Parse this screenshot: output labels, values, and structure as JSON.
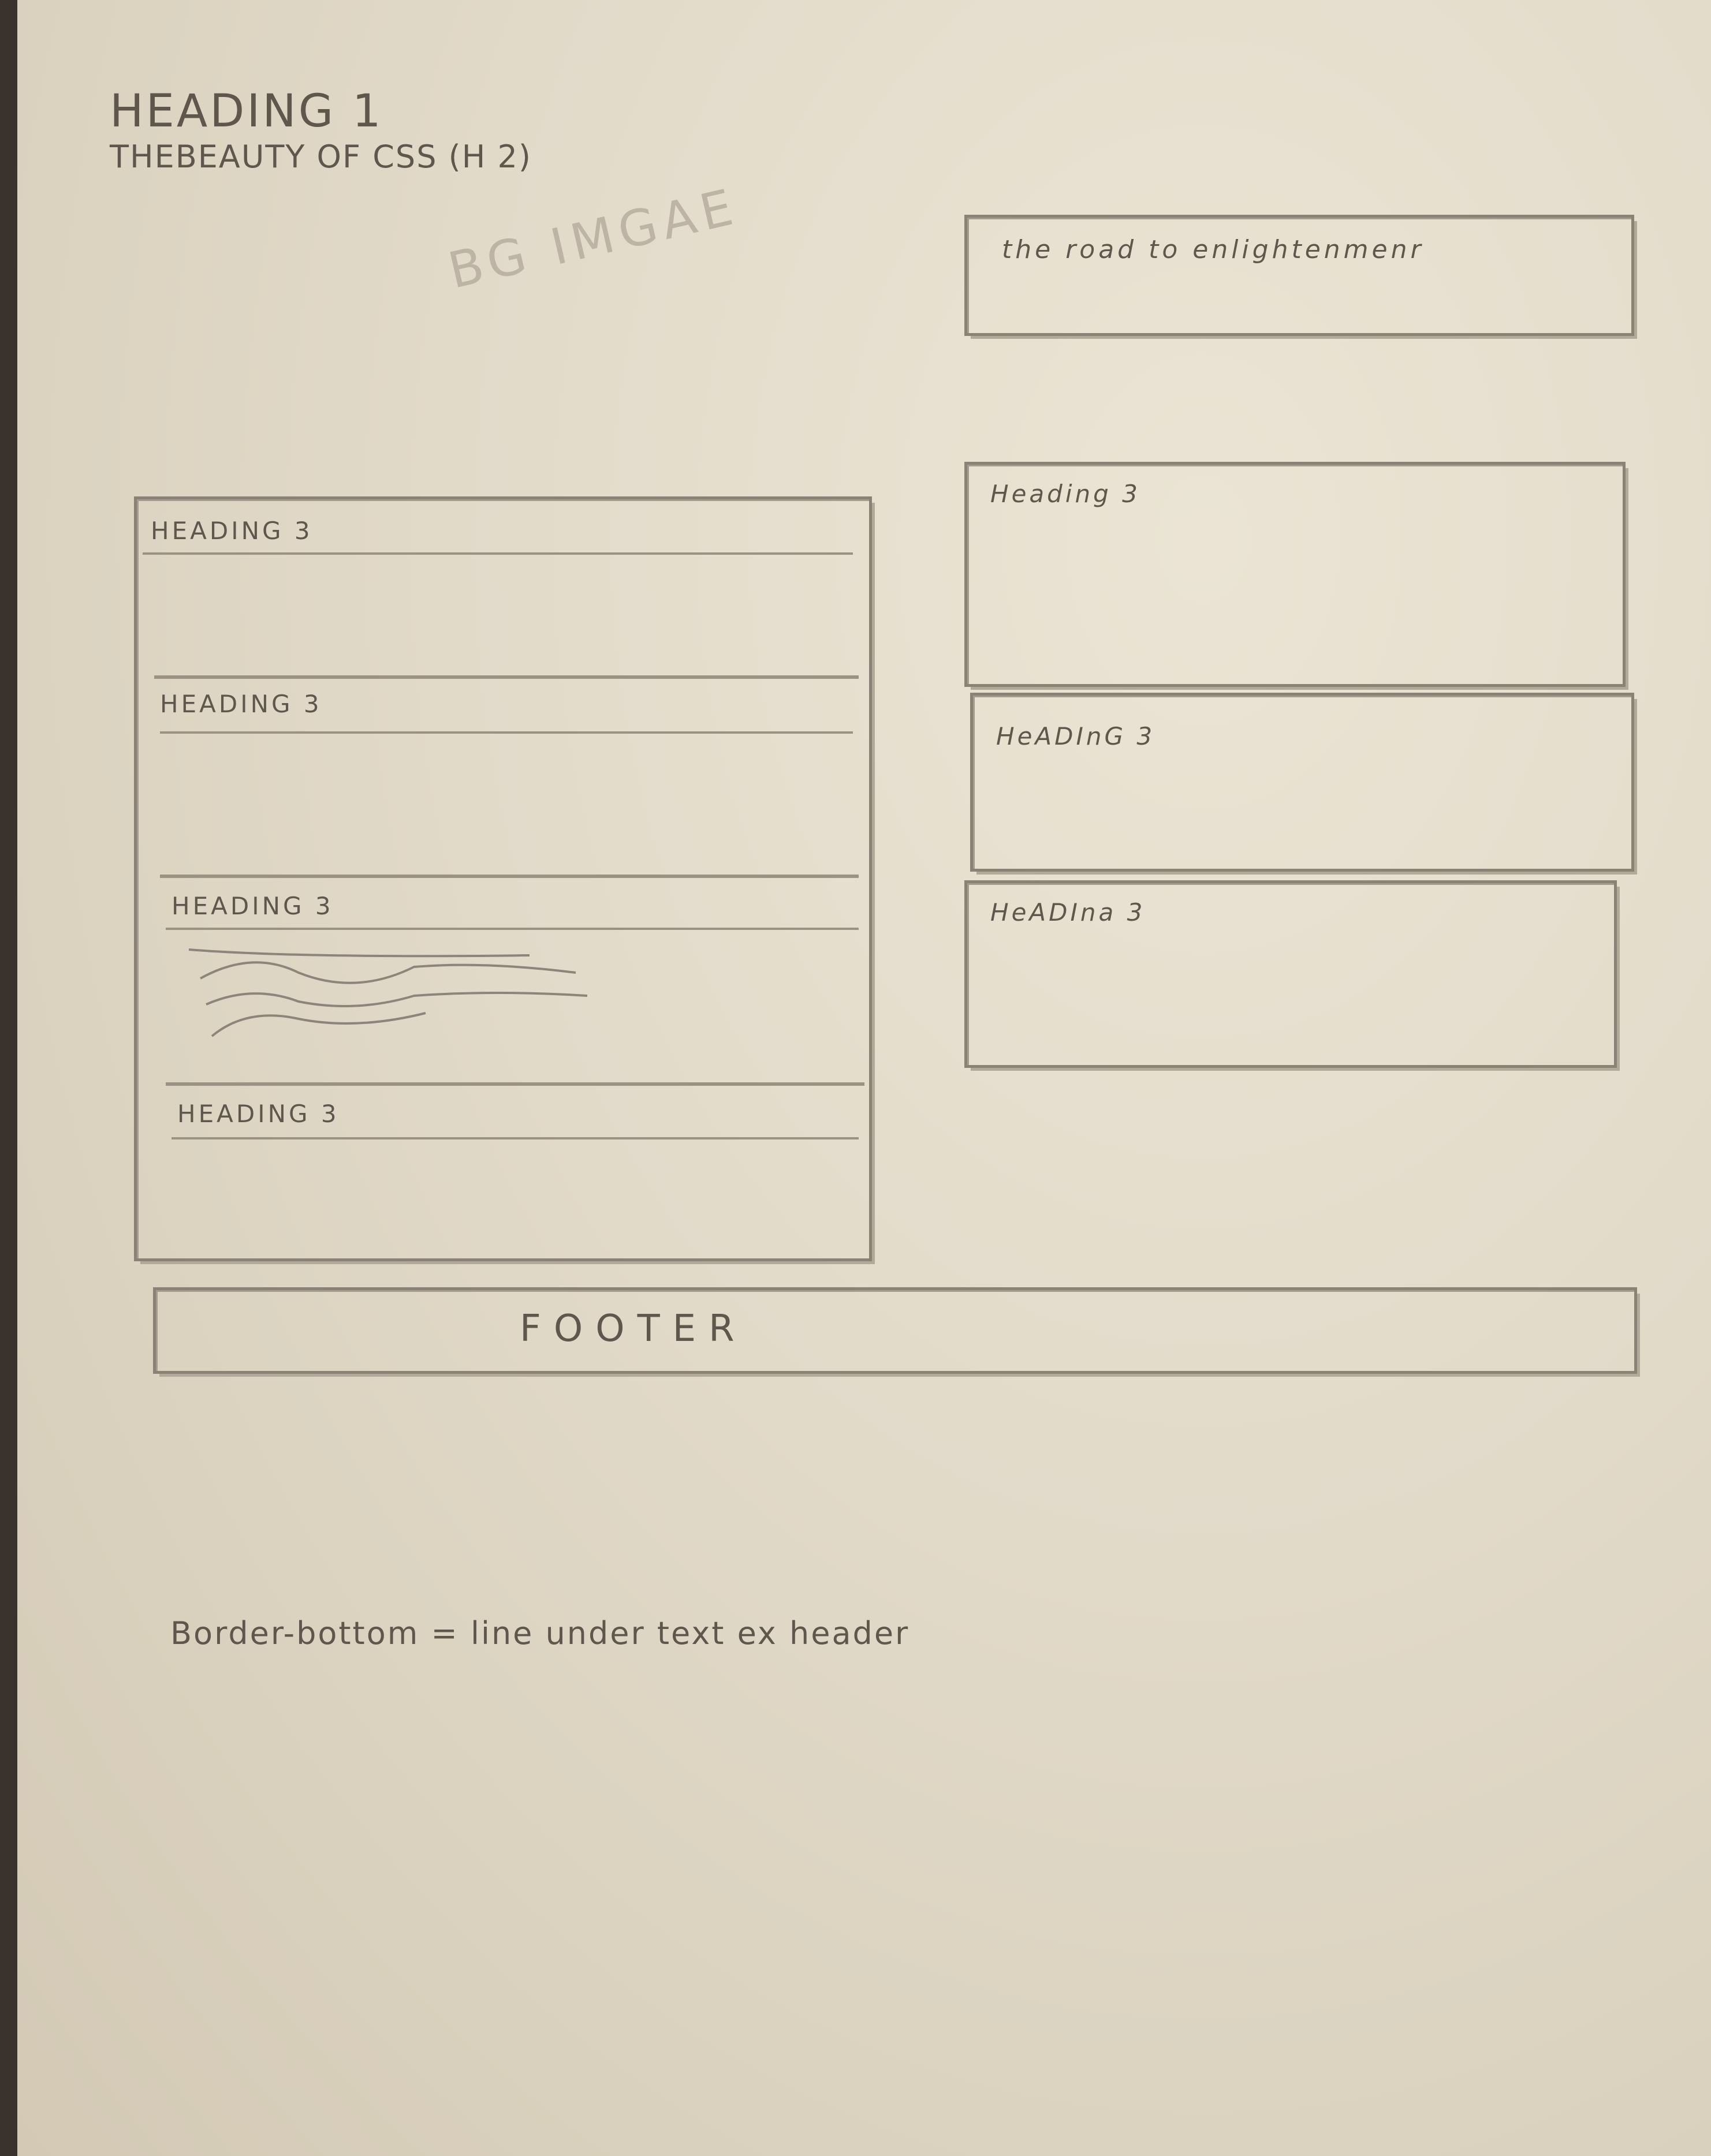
{
  "header": {
    "heading1": "HEADING 1",
    "heading2": "THEBEAUTY OF CSS (H 2)",
    "bg_label": "BG IMGAE"
  },
  "callout": {
    "text": "the road to enlightenmenr"
  },
  "left_panel": {
    "sections": [
      {
        "heading": "HEADING 3"
      },
      {
        "heading": "HEADING 3"
      },
      {
        "heading": "HEADING 3"
      },
      {
        "heading": "HEADING 3"
      }
    ]
  },
  "right_panel": {
    "cards": [
      {
        "heading": "Heading 3"
      },
      {
        "heading": "HeADInG 3"
      },
      {
        "heading": "HeADIna 3"
      }
    ]
  },
  "footer": {
    "label": "FOOTER"
  },
  "note": {
    "text": "Border-bottom = line under text ex header"
  }
}
